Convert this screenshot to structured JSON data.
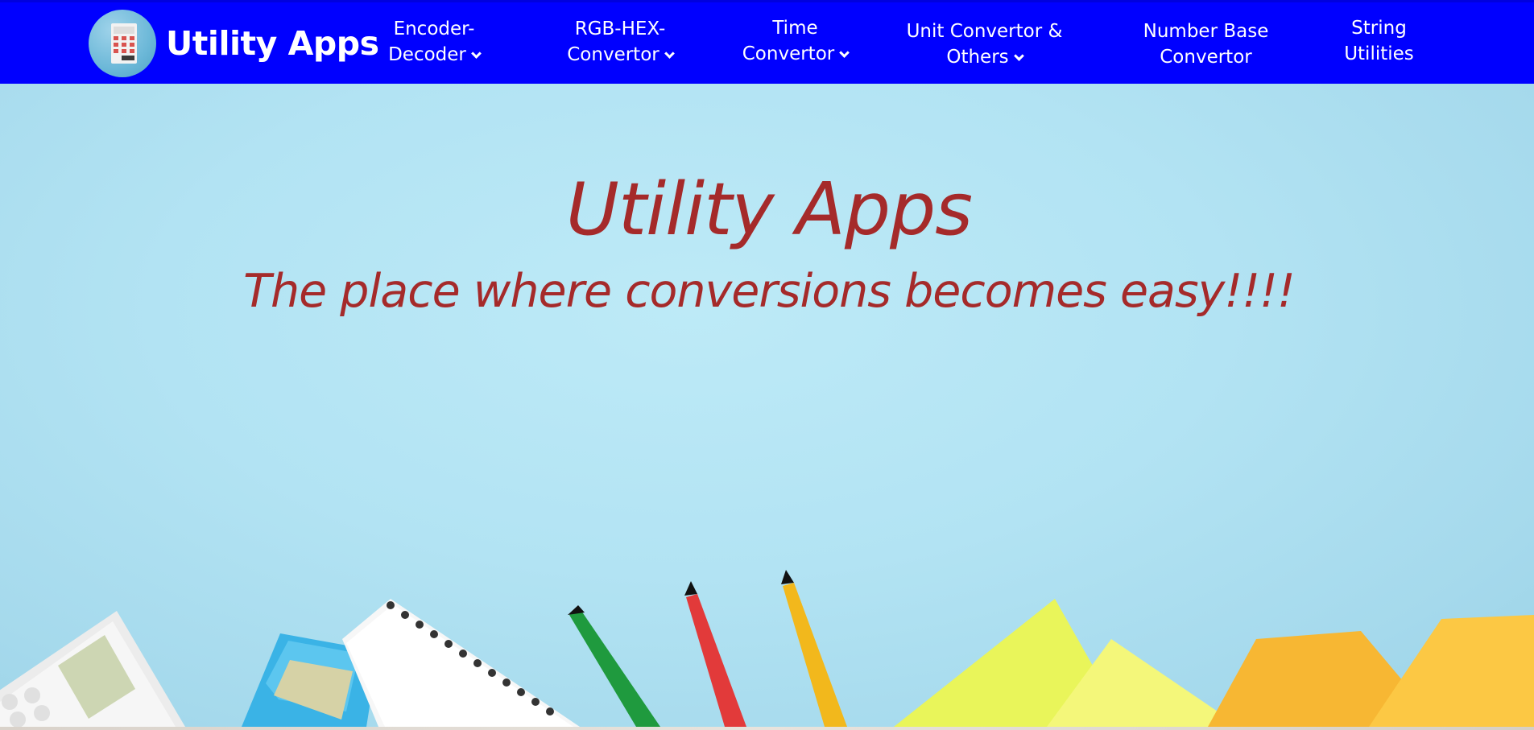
{
  "navbar": {
    "brand": {
      "name": "Utility Apps",
      "logo_icon": "calculator-icon"
    },
    "items": [
      {
        "lines": [
          "Encoder-",
          "Decoder"
        ],
        "has_dropdown": true
      },
      {
        "lines": [
          "RGB-HEX-",
          "Convertor"
        ],
        "has_dropdown": true
      },
      {
        "lines": [
          "Time",
          "Convertor"
        ],
        "has_dropdown": true
      },
      {
        "lines": [
          "Unit Convertor &",
          "Others"
        ],
        "has_dropdown": true
      },
      {
        "lines": [
          "Number Base",
          "Convertor"
        ],
        "has_dropdown": false
      },
      {
        "lines": [
          "String",
          "Utilities"
        ],
        "has_dropdown": false
      }
    ],
    "background_color": "#0000ff"
  },
  "hero": {
    "title": "Utility Apps",
    "subtitle": "The place where conversions becomes easy!!!!",
    "text_color": "#a52a2a",
    "background_color": "#b2e3f3",
    "illustration": [
      "calculator",
      "blue-calculator",
      "spiral-notebook",
      "green-pen",
      "red-pen",
      "yellow-pen",
      "sticky-notes"
    ]
  }
}
